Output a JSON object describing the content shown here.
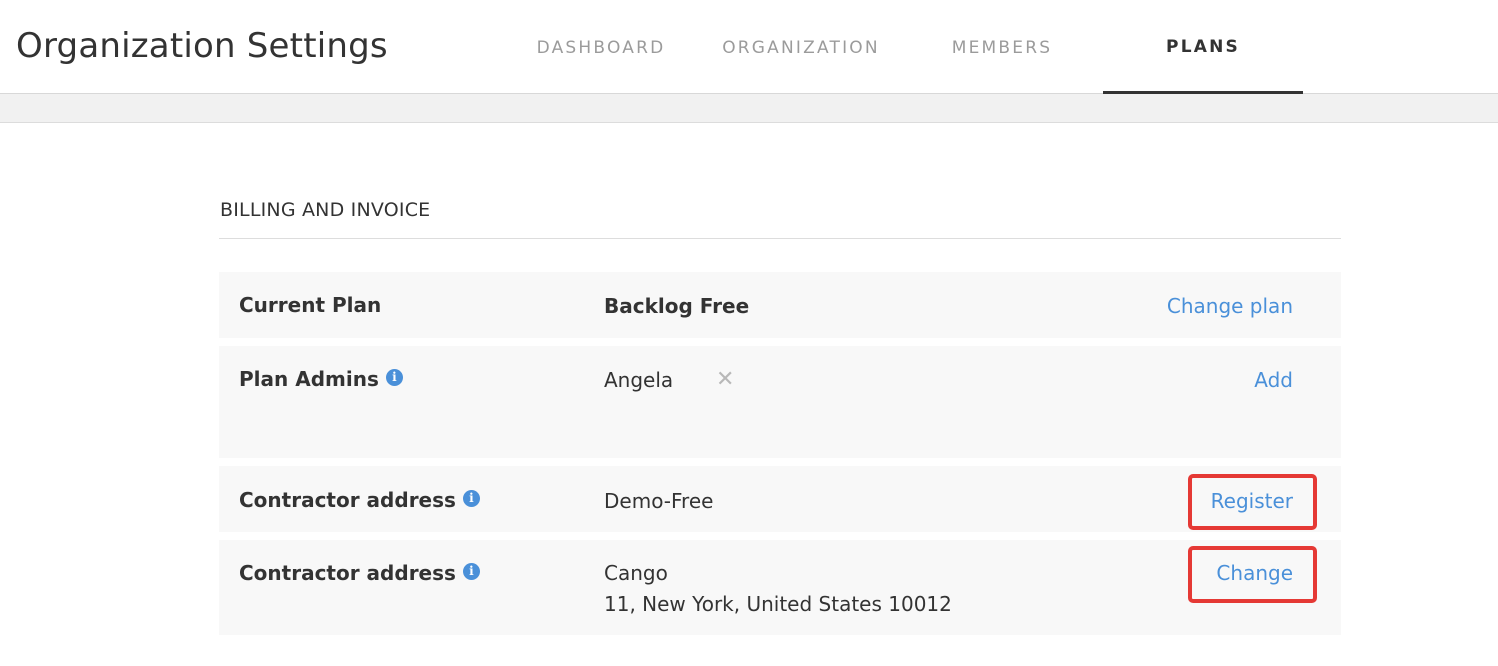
{
  "header": {
    "title": "Organization Settings",
    "tabs": [
      {
        "label": "DASHBOARD"
      },
      {
        "label": "ORGANIZATION"
      },
      {
        "label": "MEMBERS"
      },
      {
        "label": "PLANS"
      }
    ],
    "active_tab": "PLANS"
  },
  "section": {
    "title": "BILLING AND INVOICE"
  },
  "rows": [
    {
      "label": "Current Plan",
      "value": "Backlog Free",
      "action": "Change plan"
    },
    {
      "label": "Plan Admins",
      "value": "Angela",
      "action": "Add",
      "remove_icon": "close-icon"
    },
    {
      "label": "Contractor address",
      "value": "Demo-Free",
      "action": "Register"
    },
    {
      "label": "Contractor address",
      "value_line1": "Cango",
      "value_line2": "11, New York, United States 10012",
      "action": "Change"
    }
  ],
  "colors": {
    "link": "#4a90d9",
    "highlight": "#e53935",
    "row_background": "#f8f8f8"
  }
}
